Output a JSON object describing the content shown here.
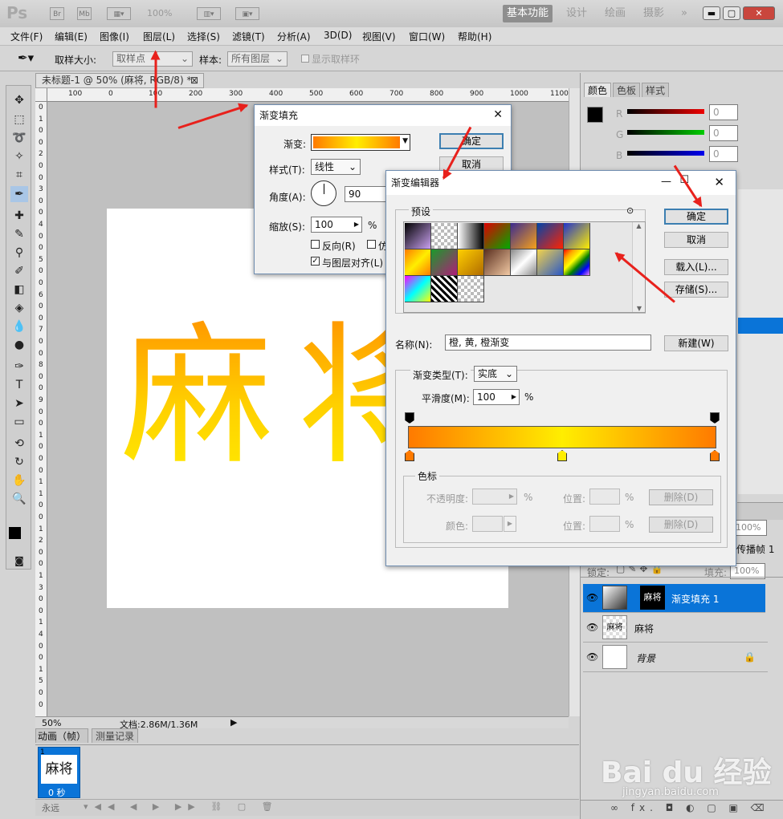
{
  "app": {
    "logo": "Ps",
    "zoom": "100%",
    "workspaces": [
      "基本功能",
      "设计",
      "绘画",
      "摄影",
      "»"
    ]
  },
  "menu": [
    "文件(F)",
    "编辑(E)",
    "图像(I)",
    "图层(L)",
    "选择(S)",
    "滤镜(T)",
    "分析(A)",
    "3D(D)",
    "视图(V)",
    "窗口(W)",
    "帮助(H)"
  ],
  "options": {
    "sample_size_label": "取样大小:",
    "sample_size_value": "取样点",
    "sample_label": "样本:",
    "sample_value": "所有图层",
    "show_ring": "显示取样环"
  },
  "document": {
    "tab": "未标题-1 @ 50% (麻将, RGB/8) *",
    "ruler_h": [
      "100",
      "0",
      "100",
      "200",
      "300",
      "400",
      "500",
      "600",
      "700",
      "800",
      "900",
      "1000",
      "1100"
    ],
    "ruler_v": [
      "0",
      "1",
      "0",
      "0",
      "2",
      "0",
      "0",
      "3",
      "0",
      "0",
      "4",
      "0",
      "0",
      "5",
      "0",
      "0",
      "6",
      "0",
      "0",
      "7",
      "0",
      "0",
      "8",
      "0",
      "0",
      "9",
      "0",
      "0",
      "1",
      "0",
      "0",
      "0",
      "1",
      "1",
      "0",
      "0",
      "1",
      "2",
      "0",
      "0",
      "1",
      "3",
      "0",
      "0",
      "1",
      "4",
      "0",
      "0",
      "1",
      "5",
      "0",
      "0"
    ],
    "art_text": "麻将",
    "zoom": "50%",
    "doc_size": "文档:2.86M/1.36M"
  },
  "anim": {
    "tabs": [
      "动画（帧）",
      "测量记录"
    ],
    "frame_no": "1",
    "frame_time": "0 秒",
    "loop": "永远",
    "frame_label": "麻将"
  },
  "right_panel": {
    "tabs": [
      "颜色",
      "色板",
      "样式"
    ],
    "channels": [
      {
        "ch": "R",
        "val": "0"
      },
      {
        "ch": "G",
        "val": "0"
      },
      {
        "ch": "B",
        "val": "0"
      }
    ],
    "opacity": "100%",
    "fill": "100%",
    "lock_label": "锁定:",
    "fill_label": "填充:",
    "propagate": "传播帧 1",
    "layers": [
      {
        "name": "渐变填充 1",
        "selected": true
      },
      {
        "name": "麻将",
        "selected": false
      },
      {
        "name": "背景",
        "selected": false
      }
    ],
    "bottom_icons": "∞ fx. ◘ ◐ ▢ ▣ ⌫"
  },
  "gradient_fill": {
    "title": "渐变填充",
    "gradient_label": "渐变:",
    "style_label": "样式(T):",
    "style_value": "线性",
    "angle_label": "角度(A):",
    "angle_value": "90",
    "scale_label": "缩放(S):",
    "scale_value": "100",
    "percent": "%",
    "reverse": "反向(R)",
    "dither": "仿",
    "align": "与图层对齐(L)",
    "ok": "确定",
    "cancel": "取消"
  },
  "gradient_editor": {
    "title": "渐变编辑器",
    "presets_label": "预设",
    "ok": "确定",
    "cancel": "取消",
    "load": "载入(L)...",
    "save": "存储(S)...",
    "name_label": "名称(N):",
    "name_value": "橙, 黄, 橙渐变",
    "new": "新建(W)",
    "type_label": "渐变类型(T):",
    "type_value": "实底",
    "smooth_label": "平滑度(M):",
    "smooth_value": "100",
    "percent": "%",
    "stops_group": "色标",
    "opacity_label": "不透明度:",
    "color_label": "颜色:",
    "location_label": "位置:",
    "delete": "删除(D)",
    "gradient_colors": [
      "#ff7a00",
      "#ffee00",
      "#ff7a00"
    ]
  },
  "watermark": {
    "brand": "Bai du 经验",
    "url": "jingyan.baidu.com"
  },
  "colors": {
    "accent": "#0a74d8",
    "arrow": "#e8211c"
  }
}
